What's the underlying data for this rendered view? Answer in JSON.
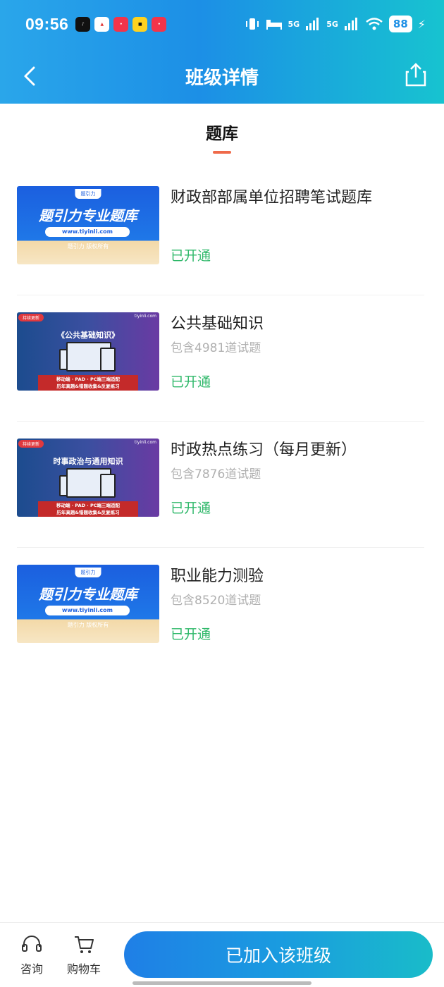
{
  "status_bar": {
    "time": "09:56",
    "battery": "88",
    "signal_1": "5G",
    "signal_2": "5G",
    "app_icons": [
      "tiktok-icon",
      "bank-app-icon",
      "task-app-icon",
      "mall-app-icon",
      "task-app-icon-2"
    ]
  },
  "nav": {
    "title": "班级详情",
    "back_icon": "chevron-left-icon",
    "share_icon": "share-icon"
  },
  "tab": {
    "label": "题库"
  },
  "items": [
    {
      "title": "财政部部属单位招聘笔试题库",
      "count": "",
      "status": "已开通",
      "thumb": {
        "style": "blue",
        "logo": "题引力",
        "headline": "题引力专业题库",
        "url": "www.tiyinli.com",
        "rights": "题引力 版权所有"
      }
    },
    {
      "title": "公共基础知识",
      "count": "包含4981道试题",
      "status": "已开通",
      "thumb": {
        "style": "purple",
        "tag": "持续更新",
        "brand": "tiyinli.com",
        "subtitle": "《公共基础知识》",
        "bar1": "移动端 · PAD · PC端三端适配",
        "bar2": "历年真题&错题收集&反复练习"
      }
    },
    {
      "title": "时政热点练习（每月更新）",
      "count": "包含7876道试题",
      "status": "已开通",
      "thumb": {
        "style": "purple",
        "tag": "持续更新",
        "brand": "tiyinli.com",
        "subtitle": "时事政治与通用知识",
        "bar1": "移动端 · PAD · PC端三端适配",
        "bar2": "历年真题&错题收集&反复练习"
      }
    },
    {
      "title": "职业能力测验",
      "count": "包含8520道试题",
      "status": "已开通",
      "thumb": {
        "style": "blue",
        "logo": "题引力",
        "headline": "题引力专业题库",
        "url": "www.tiyinli.com",
        "rights": "题引力 版权所有"
      }
    }
  ],
  "bottom_bar": {
    "consult_label": "咨询",
    "cart_label": "购物车",
    "join_button": "已加入该班级"
  },
  "colors": {
    "header_start": "#2aa6ea",
    "header_end": "#17c3d0",
    "opened_green": "#2fb86a",
    "tab_underline": "#ef6a4a"
  }
}
